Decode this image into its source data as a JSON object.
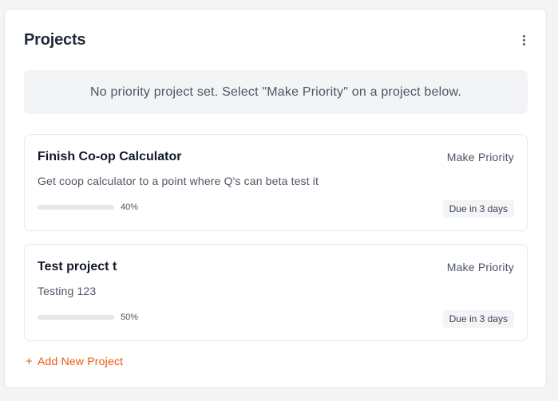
{
  "panel": {
    "title": "Projects",
    "more_icon": "more-vertical-icon"
  },
  "notice": {
    "text": "No priority project set. Select \"Make Priority\" on a project below."
  },
  "projects": [
    {
      "title": "Finish Co-op Calculator",
      "make_priority_label": "Make Priority",
      "description": "Get coop calculator to a point where Q's can beta test it",
      "progress_percent": 40,
      "progress_label": "40%",
      "due_label": "Due in 3 days"
    },
    {
      "title": "Test project t",
      "make_priority_label": "Make Priority",
      "description": "Testing 123",
      "progress_percent": 50,
      "progress_label": "50%",
      "due_label": "Due in 3 days"
    }
  ],
  "add_project": {
    "icon": "plus-icon",
    "label": "Add New Project",
    "color": "#ea580c"
  }
}
